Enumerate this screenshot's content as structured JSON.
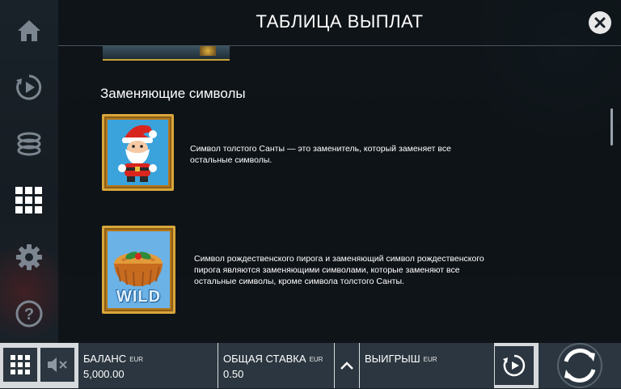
{
  "header": {
    "title": "ТАБЛИЦА ВЫПЛАТ"
  },
  "sidebar": {
    "items": [
      {
        "name": "home",
        "icon": "home-icon"
      },
      {
        "name": "autoplay",
        "icon": "autoplay-icon"
      },
      {
        "name": "bet",
        "icon": "coins-icon"
      },
      {
        "name": "paytable",
        "icon": "grid-icon",
        "active": true
      },
      {
        "name": "settings",
        "icon": "gear-icon"
      },
      {
        "name": "help",
        "icon": "question-icon"
      }
    ]
  },
  "section": {
    "title": "Заменяющие символы",
    "symbols": [
      {
        "icon": "santa-symbol",
        "description_line1": "Символ толстого Санты — это заменитель, который заменяет все",
        "description_line2": "остальные символы."
      },
      {
        "icon": "christmas-pie-wild-symbol",
        "badge": "WILD",
        "description_line1": "Символ рождественского пирога и заменяющий символ рождественского",
        "description_line2": "пирога являются заменяющими символами, которые заменяют все",
        "description_line3": "остальные символы, кроме символа толстого Санты."
      }
    ]
  },
  "bottom_bar": {
    "balance": {
      "label": "БАЛАНС",
      "currency": "EUR",
      "value": "5,000.00"
    },
    "total_bet": {
      "label": "ОБЩАЯ СТАВКА",
      "currency": "EUR",
      "value": "0.50"
    },
    "win": {
      "label": "ВЫИГРЫШ",
      "currency": "EUR",
      "value": ""
    }
  },
  "colors": {
    "panel": "#0c1014",
    "accent_gold": "#d8a63a",
    "bar_dark": "#2b3640",
    "bar_light": "#d6dadd"
  }
}
